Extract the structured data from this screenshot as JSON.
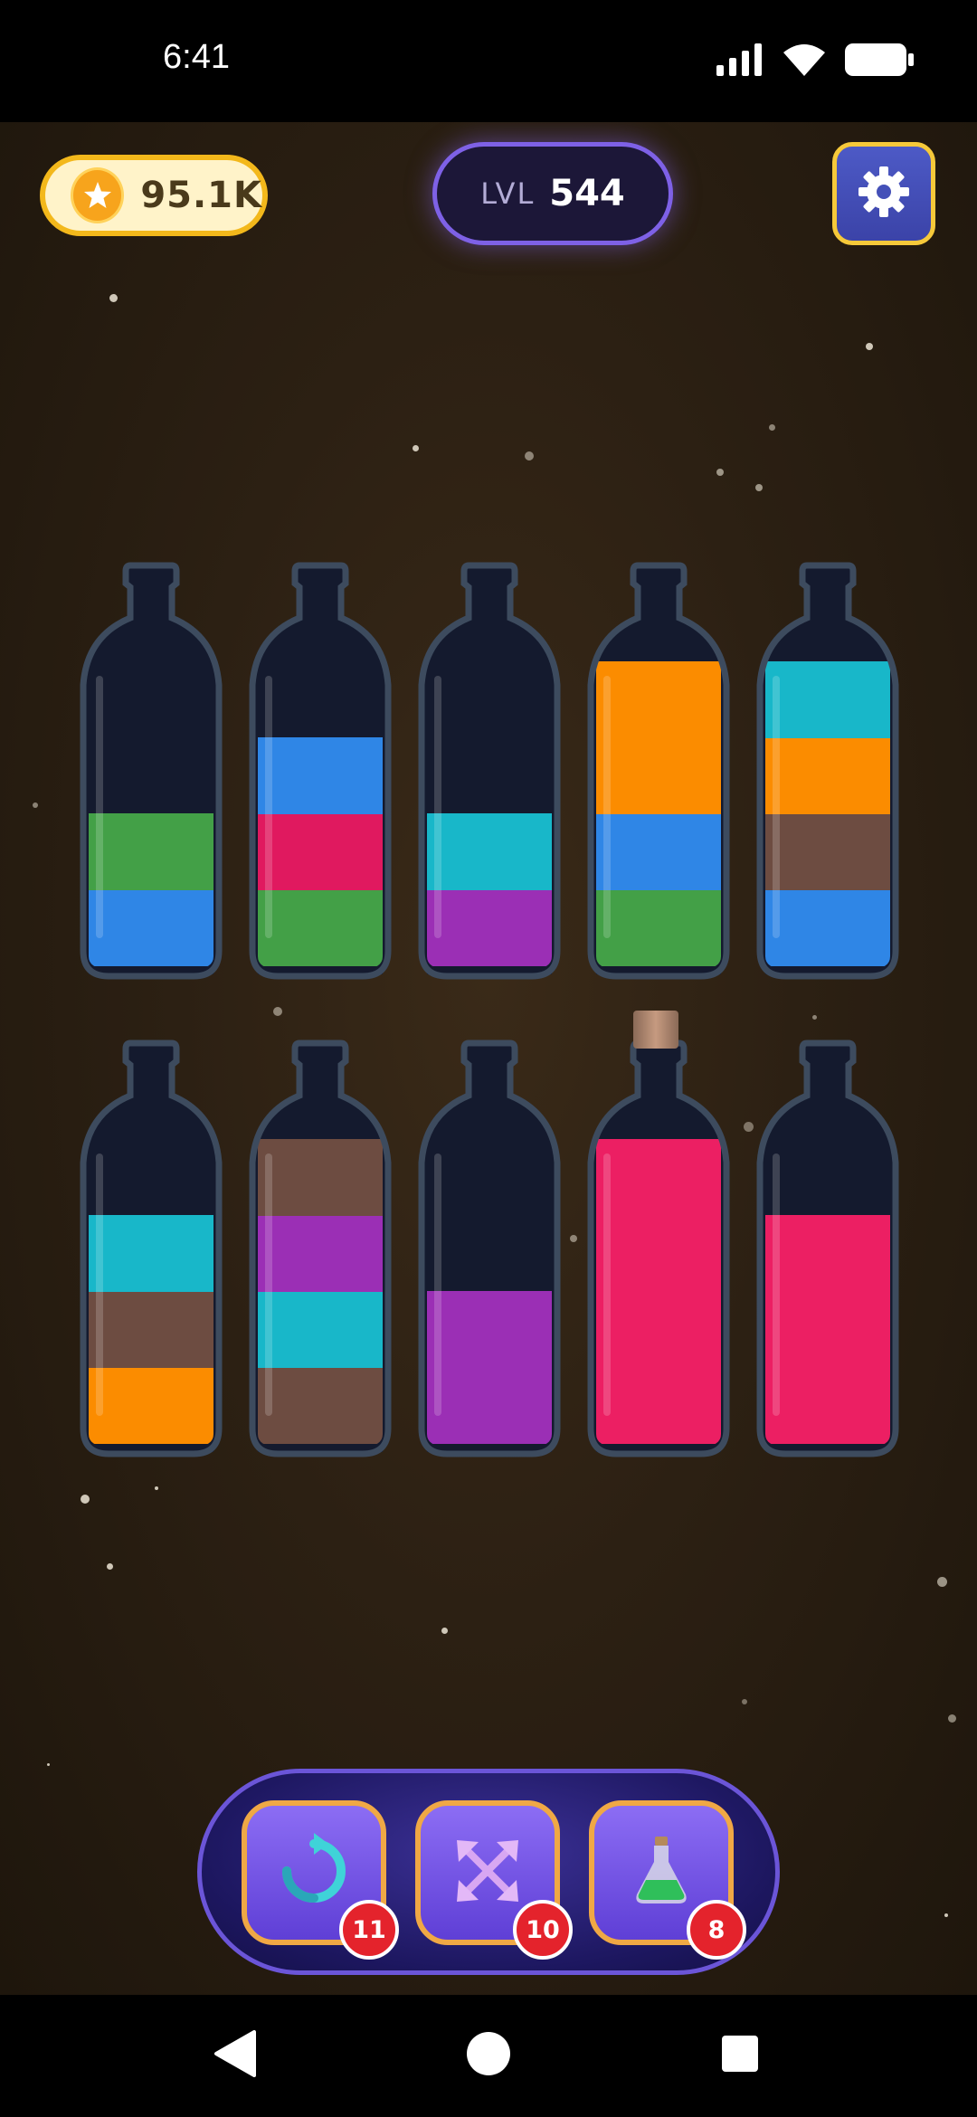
{
  "status_bar": {
    "time": "6:41"
  },
  "header": {
    "coins": "95.1K",
    "level_prefix": "LVL",
    "level_number": "544"
  },
  "bottles": [
    {
      "row": 1,
      "layers": [
        "#2f86e6",
        "#43a047"
      ],
      "capped": false
    },
    {
      "row": 1,
      "layers": [
        "#43a047",
        "#e0195f",
        "#2f86e6"
      ],
      "capped": false
    },
    {
      "row": 1,
      "layers": [
        "#9b2fb5",
        "#18b7c9"
      ],
      "capped": false
    },
    {
      "row": 1,
      "layers": [
        "#43a047",
        "#2f86e6",
        "#fb8c00",
        "#fb8c00"
      ],
      "capped": false
    },
    {
      "row": 1,
      "layers": [
        "#2f86e6",
        "#6d4c41",
        "#fb8c00",
        "#18b7c9"
      ],
      "capped": false
    },
    {
      "row": 2,
      "layers": [
        "#fb8c00",
        "#6d4c41",
        "#18b7c9"
      ],
      "capped": false
    },
    {
      "row": 2,
      "layers": [
        "#6d4c41",
        "#18b7c9",
        "#9b2fb5",
        "#6d4c41"
      ],
      "capped": false
    },
    {
      "row": 2,
      "layers": [
        "#9b2fb5",
        "#9b2fb5"
      ],
      "capped": false
    },
    {
      "row": 2,
      "layers": [
        "#ec1f63",
        "#ec1f63",
        "#ec1f63",
        "#ec1f63"
      ],
      "capped": true
    },
    {
      "row": 2,
      "layers": [
        "#ec1f63",
        "#ec1f63",
        "#ec1f63"
      ],
      "capped": false
    }
  ],
  "boosters": [
    {
      "name": "undo",
      "icon": "refresh-icon",
      "count": "11"
    },
    {
      "name": "shuffle",
      "icon": "shuffle-arrows-icon",
      "count": "10"
    },
    {
      "name": "extra-bottle",
      "icon": "potion-flask-icon",
      "count": "8"
    }
  ],
  "colors": {
    "accent_purple": "#6b55d8",
    "gold": "#f3b81b",
    "booster_border": "#f0a845",
    "badge_red": "#e4232c"
  }
}
